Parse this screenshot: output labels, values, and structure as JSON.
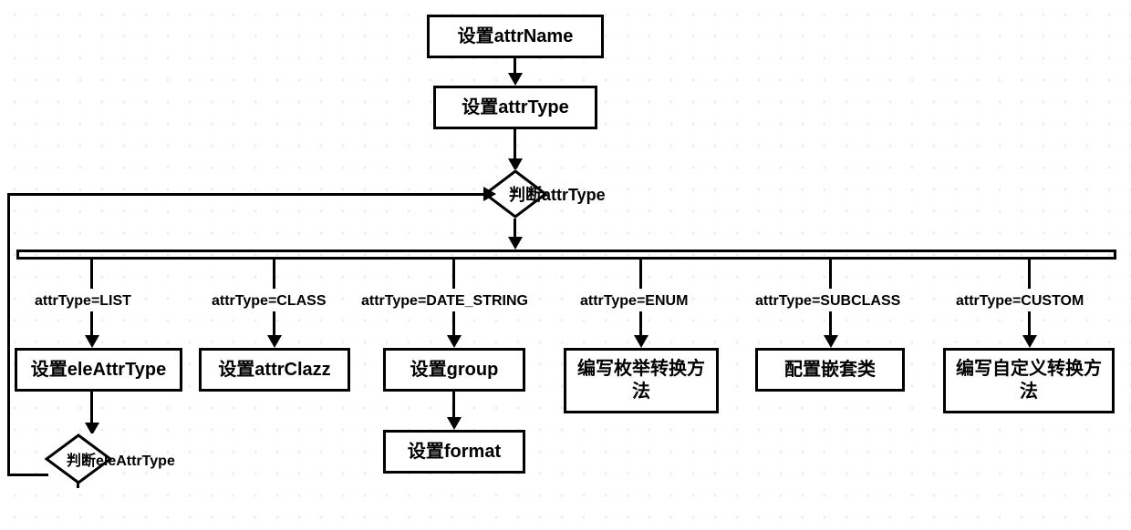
{
  "flow": {
    "step1": "设置attrName",
    "step2": "设置attrType",
    "decision1": "判断attrType",
    "branches": {
      "list": {
        "cond": "attrType=LIST",
        "action": "设置eleAttrType",
        "sub_decision": "判断eleAttrType"
      },
      "class": {
        "cond": "attrType=CLASS",
        "action": "设置attrClazz"
      },
      "date_string": {
        "cond": "attrType=DATE_STRING",
        "action": "设置group",
        "next": "设置format"
      },
      "enum": {
        "cond": "attrType=ENUM",
        "action": "编写枚举转换方法"
      },
      "subclass": {
        "cond": "attrType=SUBCLASS",
        "action": "配置嵌套类"
      },
      "custom": {
        "cond": "attrType=CUSTOM",
        "action": "编写自定义转换方法"
      }
    }
  }
}
